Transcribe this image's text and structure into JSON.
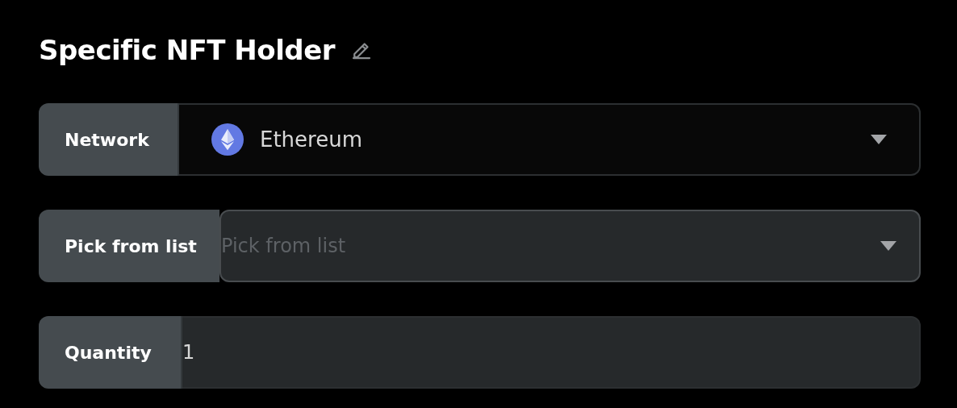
{
  "title": "Specific NFT Holder",
  "fields": [
    {
      "kind": "token-select",
      "label": "Network",
      "value": "Ethereum"
    },
    {
      "kind": "select",
      "label": "Pick from list",
      "placeholder": "Pick from list"
    },
    {
      "kind": "input",
      "label": "Quantity",
      "value": "1"
    }
  ]
}
